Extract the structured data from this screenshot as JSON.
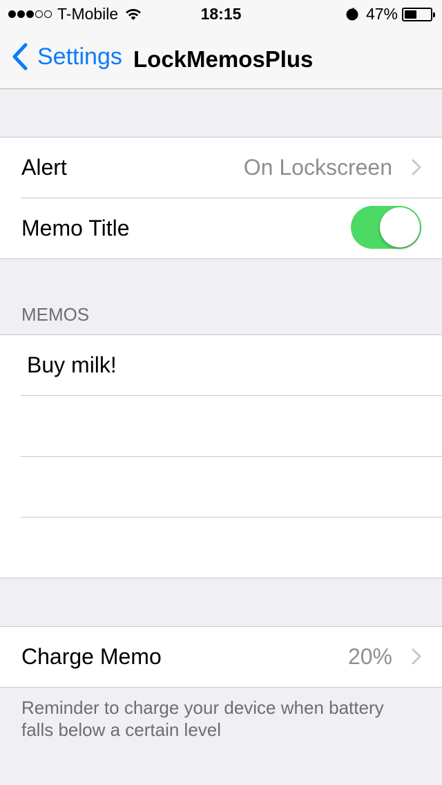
{
  "status_bar": {
    "signal_dots_filled": 3,
    "signal_dots_total": 5,
    "carrier": "T-Mobile",
    "time": "18:15",
    "battery_percent": "47%",
    "battery_level": 0.47
  },
  "nav": {
    "back_label": "Settings",
    "title": "LockMemosPlus"
  },
  "settings": {
    "alert_label": "Alert",
    "alert_value": "On Lockscreen",
    "memo_title_label": "Memo Title",
    "memo_title_enabled": true
  },
  "memos": {
    "header": "MEMOS",
    "items": [
      "Buy milk!",
      "",
      "",
      ""
    ]
  },
  "charge": {
    "label": "Charge Memo",
    "value": "20%",
    "footer": "Reminder to charge your device when battery falls below a certain level"
  },
  "colors": {
    "accent": "#0a7aff",
    "toggle_on": "#4cd964",
    "background": "#efeff4"
  }
}
